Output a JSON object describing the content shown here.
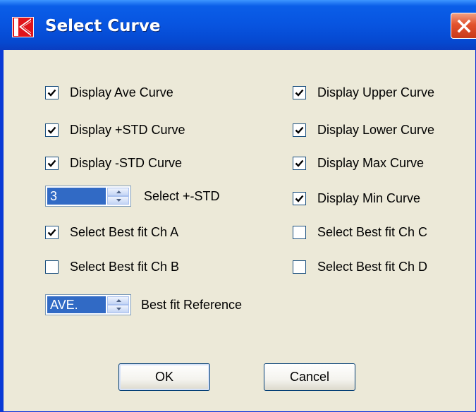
{
  "window": {
    "title": "Select Curve",
    "icons": {
      "app": "app-logo-icon",
      "close": "close-icon"
    },
    "colors": {
      "titlebar": "#0854e0",
      "body": "#ece9d8",
      "close": "#e2522e",
      "selection": "#316ac5"
    }
  },
  "left_column": {
    "display_ave": {
      "label": "Display Ave Curve",
      "checked": true
    },
    "display_plus_std": {
      "label": "Display +STD Curve",
      "checked": true
    },
    "display_minus_std": {
      "label": "Display -STD Curve",
      "checked": true
    },
    "std_spinner": {
      "value": "3",
      "label": "Select +-STD"
    },
    "best_fit_a": {
      "label": "Select Best fit Ch A",
      "checked": true
    },
    "best_fit_b": {
      "label": "Select Best fit Ch B",
      "checked": false
    },
    "reference_spinner": {
      "value": "AVE.",
      "label": "Best fit Reference"
    }
  },
  "right_column": {
    "display_upper": {
      "label": "Display Upper Curve",
      "checked": true
    },
    "display_lower": {
      "label": "Display Lower Curve",
      "checked": true
    },
    "display_max": {
      "label": "Display Max Curve",
      "checked": true
    },
    "display_min": {
      "label": "Display Min Curve",
      "checked": true
    },
    "best_fit_c": {
      "label": "Select Best fit Ch C",
      "checked": false
    },
    "best_fit_d": {
      "label": "Select Best fit Ch D",
      "checked": false
    }
  },
  "buttons": {
    "ok": "OK",
    "cancel": "Cancel"
  }
}
